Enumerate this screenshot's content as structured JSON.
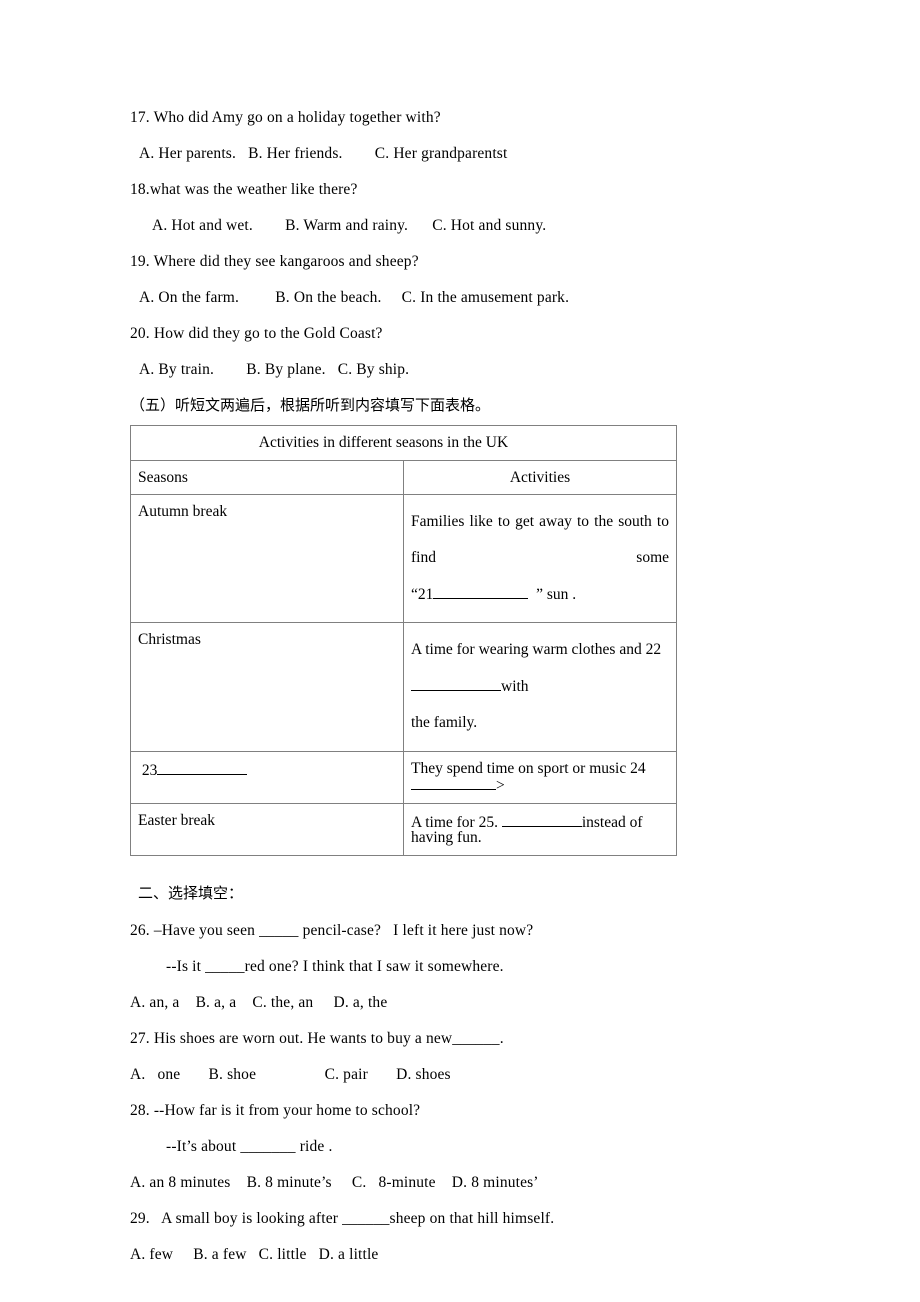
{
  "document": {
    "type": "english-exam-paper",
    "language": "en-zh"
  },
  "listening_section": {
    "questions": [
      {
        "id": "17",
        "stem": "17. Who did Amy go on a holiday together with?",
        "options": "A. Her parents.   B. Her friends.        C. Her grandparentst"
      },
      {
        "id": "18",
        "stem": "18.what was the weather like there?",
        "options": "A. Hot and wet.        B. Warm and rainy.      C. Hot and sunny."
      },
      {
        "id": "19",
        "stem": "19. Where did they see kangaroos and sheep?",
        "options": "A. On the farm.         B. On the beach.     C. In the amusement park."
      },
      {
        "id": "20",
        "stem": "20. How did they go to the Gold Coast?",
        "options": "A. By train.        B. By plane.   C. By ship."
      }
    ],
    "part_five_instruction": "（五）听短文两遍后，根据所听到内容填写下面表格。"
  },
  "table": {
    "title": "Activities in different seasons in the UK",
    "headers": {
      "season": "Seasons",
      "activities": "Activities"
    },
    "rows": [
      {
        "season": "Autumn break",
        "activity_line1": "Families like to get away to the south to find some",
        "activity_line2_pre": "“21",
        "activity_line2_post": "” sun ."
      },
      {
        "season": "Christmas",
        "activity_line1_pre": "A   time for wearing warm clothes and 22",
        "activity_line1_post": "with",
        "activity_line2": "the family."
      },
      {
        "season_pre": "23",
        "activity_pre": "They spend time on sport or music 24",
        "activity_post": ">"
      },
      {
        "season": "Easter break",
        "activity_pre": "A time for   25. ",
        "activity_post": "instead of having fun."
      }
    ]
  },
  "choice_section": {
    "heading": "二、选择填空：",
    "questions": [
      {
        "id": "26",
        "stem_line1": "26. –Have you seen _____ pencil-case?   I left it here just now?",
        "stem_line2": "--Is it _____red one? I think that I saw it somewhere.",
        "options": "A. an, a    B. a, a    C. the, an     D. a, the"
      },
      {
        "id": "27",
        "stem_line1": "27. His shoes are worn out. He wants to buy a new______.",
        "options": "A.   one       B. shoe                 C. pair       D. shoes"
      },
      {
        "id": "28",
        "stem_line1": "28. --How far is it from your home to school?",
        "stem_line2": "--It’s about _______ ride .",
        "options": "A. an 8 minutes    B. 8 minute’s     C.   8-minute    D. 8 minutes’"
      },
      {
        "id": "29",
        "stem_line1": "29.   A small boy is looking after ______sheep on that hill himself.",
        "options": "A. few     B. a few   C. little   D. a little"
      }
    ]
  }
}
